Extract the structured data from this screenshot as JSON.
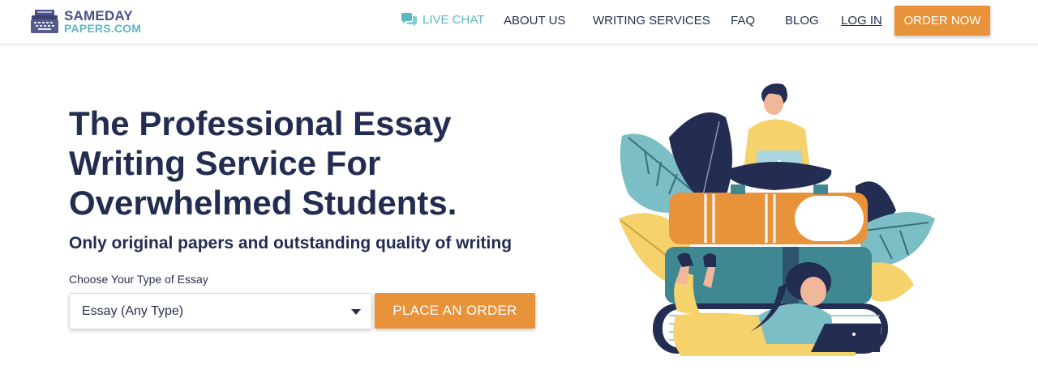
{
  "brand": {
    "name_line1": "SAMEDAY",
    "name_line2": "PAPERS.COM",
    "icon": "typewriter-icon"
  },
  "nav": {
    "live_chat": "LIVE CHAT",
    "live_chat_icon": "chat-bubbles-icon",
    "about": "ABOUT US",
    "writing_services": "WRITING SERVICES",
    "faq": "FAQ",
    "blog": "BLOG",
    "login": "LOG IN",
    "order_now": "ORDER NOW"
  },
  "hero": {
    "title_lines": [
      "The Professional Essay",
      "Writing Service For",
      "Overwhelmed Students."
    ],
    "subtitle": "Only original papers and outstanding quality of writing",
    "choose_label": "Choose Your Type of Essay",
    "essay_type_selected": "Essay (Any Type)",
    "place_order": "PLACE AN ORDER",
    "illustration": "students-books-laptops-illustration"
  },
  "colors": {
    "accent_orange": "#e8923a",
    "navy": "#232c51",
    "teal": "#5bb7c4",
    "brand_purple": "#4b4f8a"
  }
}
